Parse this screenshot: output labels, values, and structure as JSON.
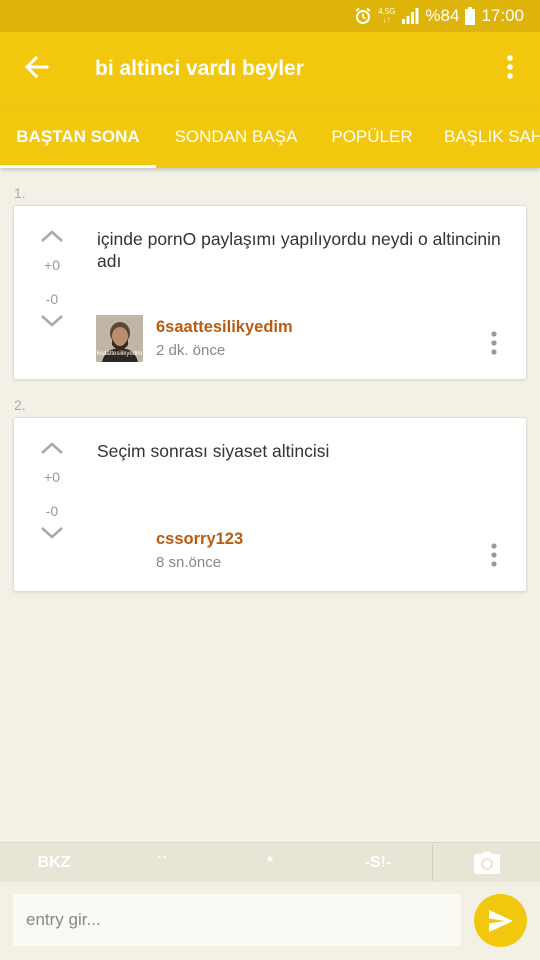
{
  "status_bar": {
    "network_top": "4.5G",
    "network_bottom": "↓↑",
    "battery": "%84",
    "time": "17:00"
  },
  "app_bar": {
    "title": "bi altinci vardı beyler",
    "back_icon": "arrow-left-icon",
    "menu_icon": "more-vertical-icon"
  },
  "tabs": [
    {
      "label": "BAŞTAN SONA",
      "active": true
    },
    {
      "label": "SONDAN BAŞA",
      "active": false
    },
    {
      "label": "POPÜLER",
      "active": false
    },
    {
      "label": "BAŞLIK SAHİBİ",
      "active": false
    }
  ],
  "entries": [
    {
      "number": "1.",
      "text": "içinde pornO paylaşımı yapılıyordu neydi o altincinin adı",
      "upvotes": "+0",
      "downvotes": "-0",
      "author": "6saattesilikyedim",
      "time": "2 dk. önce",
      "avatar_caption": "6saattesilikyedim"
    },
    {
      "number": "2.",
      "text": "Seçim sonrası siyaset altincisi",
      "upvotes": "+0",
      "downvotes": "-0",
      "author": "cssorry123",
      "time": "8 sn.önce"
    }
  ],
  "toolbar": {
    "bkz": "BKZ",
    "backticks": "``",
    "asterisk": "*",
    "spoiler": "-S!-",
    "camera_icon": "camera-icon"
  },
  "input": {
    "placeholder": "entry gir...",
    "value": ""
  },
  "colors": {
    "status_bar": "#dfb40a",
    "app_bar": "#f2c80f",
    "background": "#f3f0e6",
    "author": "#b85c10"
  }
}
